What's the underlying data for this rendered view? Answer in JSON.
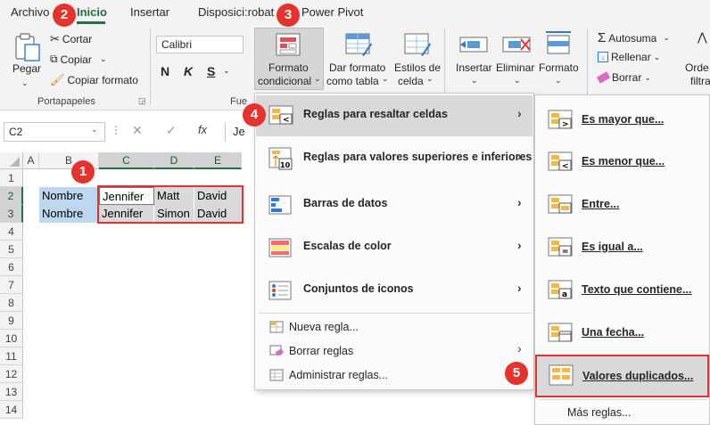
{
  "tabs": {
    "archivo": "Archivo",
    "inicio": "Inicio",
    "insertar": "Insertar",
    "disposicion": "Disposici:robat",
    "powerpivot": "Power Pivot"
  },
  "ribbon": {
    "pegar": "Pegar",
    "cortar": "Cortar",
    "copiar": "Copiar",
    "copiar_formato": "Copiar formato",
    "portapapeles": "Portapapeles",
    "font_name": "Calibri",
    "bold": "N",
    "italic": "K",
    "underline": "S",
    "fuente_label": "Fue",
    "formato_condicional_1": "Formato",
    "formato_condicional_2": "condicional",
    "dar_formato_1": "Dar formato",
    "dar_formato_2": "como tabla",
    "estilos_celda_1": "Estilos de",
    "estilos_celda_2": "celda",
    "insertar": "Insertar",
    "eliminar": "Eliminar",
    "formato": "Formato",
    "autosuma": "Autosuma",
    "rellenar": "Rellenar",
    "borrar": "Borrar",
    "ordenar_1": "Orde",
    "ordenar_2": "filtra"
  },
  "formula_bar": {
    "namebox": "C2",
    "fx": "fx",
    "content": "Je"
  },
  "grid": {
    "columns": [
      "A",
      "B",
      "C",
      "D",
      "E"
    ],
    "rows": [
      "1",
      "2",
      "3",
      "4",
      "5",
      "6",
      "7",
      "8",
      "9",
      "10",
      "11",
      "12",
      "13",
      "14"
    ],
    "row2": [
      "Nombre",
      "Jennifer",
      "Matt",
      "David"
    ],
    "row3": [
      "Nombre",
      "Jennifer",
      "Simon",
      "David"
    ]
  },
  "menu1": {
    "resaltar": "Reglas para resaltar celdas",
    "superiores": "Reglas para valores superiores e inferiores",
    "barras": "Barras de datos",
    "escalas": "Escalas de color",
    "iconos": "Conjuntos de iconos",
    "nueva": "Nueva regla...",
    "borrar": "Borrar reglas",
    "administrar": "Administrar reglas..."
  },
  "menu2": {
    "mayor": "Es mayor que...",
    "menor": "Es menor que...",
    "entre": "Entre...",
    "igual": "Es igual a...",
    "texto": "Texto que contiene...",
    "fecha": "Una fecha...",
    "duplicados": "Valores duplicados...",
    "mas": "Más reglas..."
  },
  "badges": [
    "1",
    "2",
    "3",
    "4",
    "5"
  ],
  "colors": {
    "accent_green": "#217346",
    "highlight_red": "#e5322d",
    "nombre_fill": "#bdd7ee",
    "selected_fill": "#d9d9d9"
  }
}
